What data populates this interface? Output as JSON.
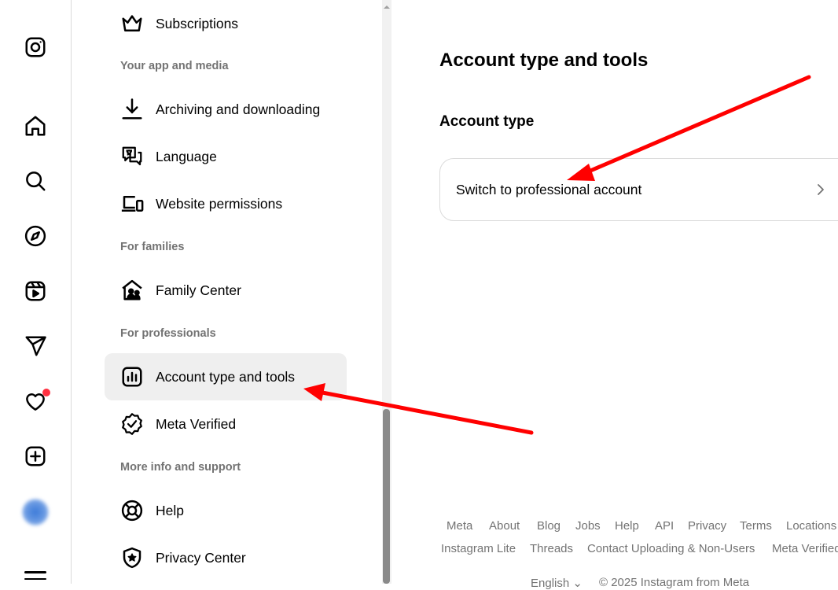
{
  "rail": {
    "icons": [
      "instagram-logo-icon",
      "home-icon",
      "search-icon",
      "explore-icon",
      "reels-icon",
      "messages-icon",
      "notifications-icon",
      "create-icon",
      "profile-avatar",
      "more-menu-icon"
    ]
  },
  "settings": {
    "items": [
      {
        "label": "Subscriptions",
        "icon": "crown-icon"
      },
      {
        "label": "Archiving and downloading",
        "icon": "download-icon"
      },
      {
        "label": "Language",
        "icon": "language-icon"
      },
      {
        "label": "Website permissions",
        "icon": "devices-icon"
      },
      {
        "label": "Family Center",
        "icon": "family-home-icon"
      },
      {
        "label": "Account type and tools",
        "icon": "chart-icon"
      },
      {
        "label": "Meta Verified",
        "icon": "verified-badge-icon"
      },
      {
        "label": "Help",
        "icon": "lifebuoy-icon"
      },
      {
        "label": "Privacy Center",
        "icon": "shield-star-icon"
      }
    ],
    "headers": [
      "Your app and media",
      "For families",
      "For professionals",
      "More info and support"
    ]
  },
  "main": {
    "title": "Account type and tools",
    "section_title": "Account type",
    "card_label": "Switch to professional account"
  },
  "footer": {
    "row1": [
      "Meta",
      "About",
      "Blog",
      "Jobs",
      "Help",
      "API",
      "Privacy",
      "Terms",
      "Locations"
    ],
    "row2": [
      "Instagram Lite",
      "Threads",
      "Contact Uploading & Non-Users",
      "Meta Verified"
    ],
    "language": "English",
    "copyright": "© 2025 Instagram from Meta"
  },
  "colors": {
    "annotation_arrow": "#ff0000",
    "active_bg": "#efefef",
    "muted_text": "#737373",
    "notification_dot": "#ff3040"
  }
}
